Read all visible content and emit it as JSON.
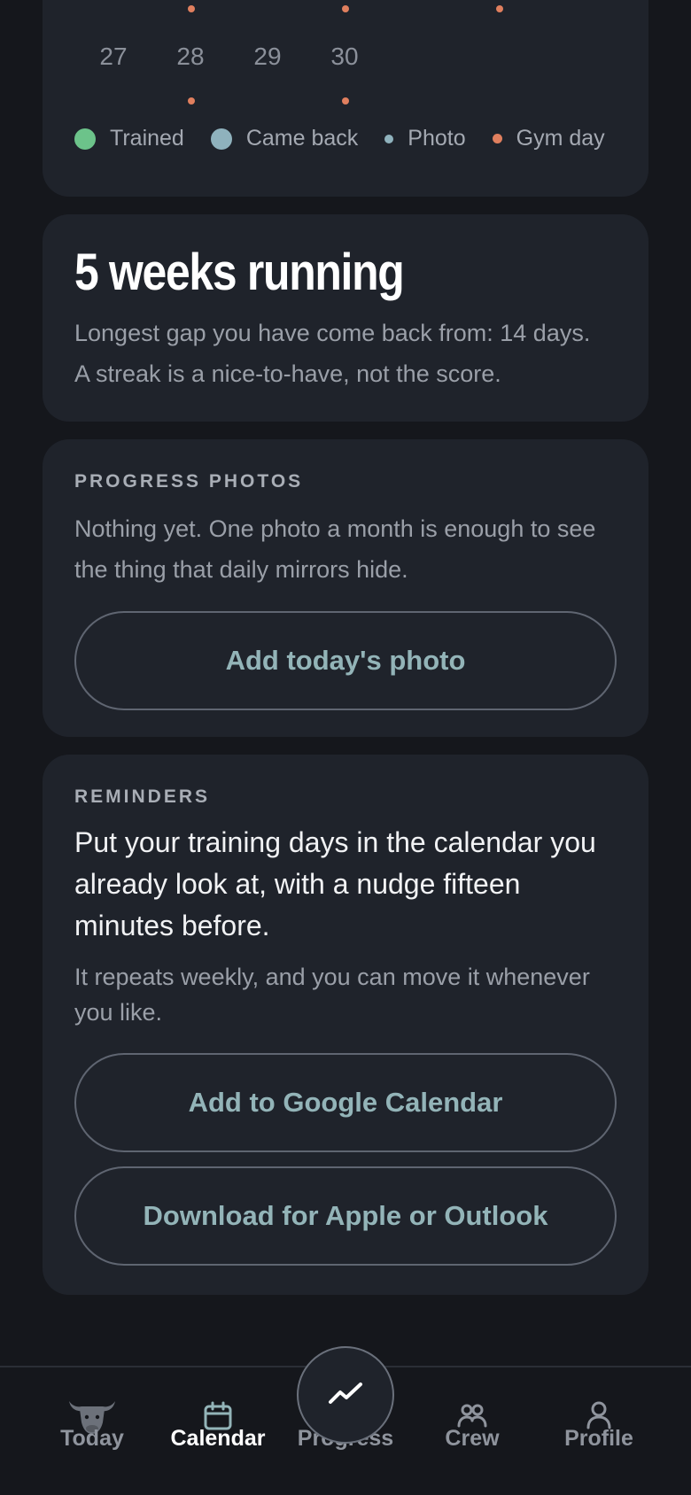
{
  "calendar": {
    "days": [
      "27",
      "28",
      "29",
      "30"
    ],
    "legend": [
      {
        "label": "Trained",
        "color": "#6cc38a"
      },
      {
        "label": "Came back",
        "color": "#8fb2bd"
      },
      {
        "label": "Photo",
        "color": "#8fb2bd"
      },
      {
        "label": "Gym day",
        "color": "#e07f5e"
      }
    ]
  },
  "streak": {
    "title": "5 weeks running",
    "line1": "Longest gap you have come back from: 14 days.",
    "line2": "A streak is a nice-to-have, not the score."
  },
  "photos": {
    "label": "PROGRESS PHOTOS",
    "text": "Nothing yet. One photo a month is enough to see the thing that daily mirrors hide.",
    "button": "Add today's photo"
  },
  "reminders": {
    "label": "REMINDERS",
    "main": "Put your training days in the calendar you already look at, with a nudge fifteen minutes before.",
    "sub": "It repeats weekly, and you can move it whenever you like.",
    "google_button": "Add to Google Calendar",
    "apple_button": "Download for Apple or Outlook"
  },
  "nav": {
    "today": "Today",
    "calendar": "Calendar",
    "progress": "Progress",
    "crew": "Crew",
    "profile": "Profile",
    "active": "Calendar"
  }
}
